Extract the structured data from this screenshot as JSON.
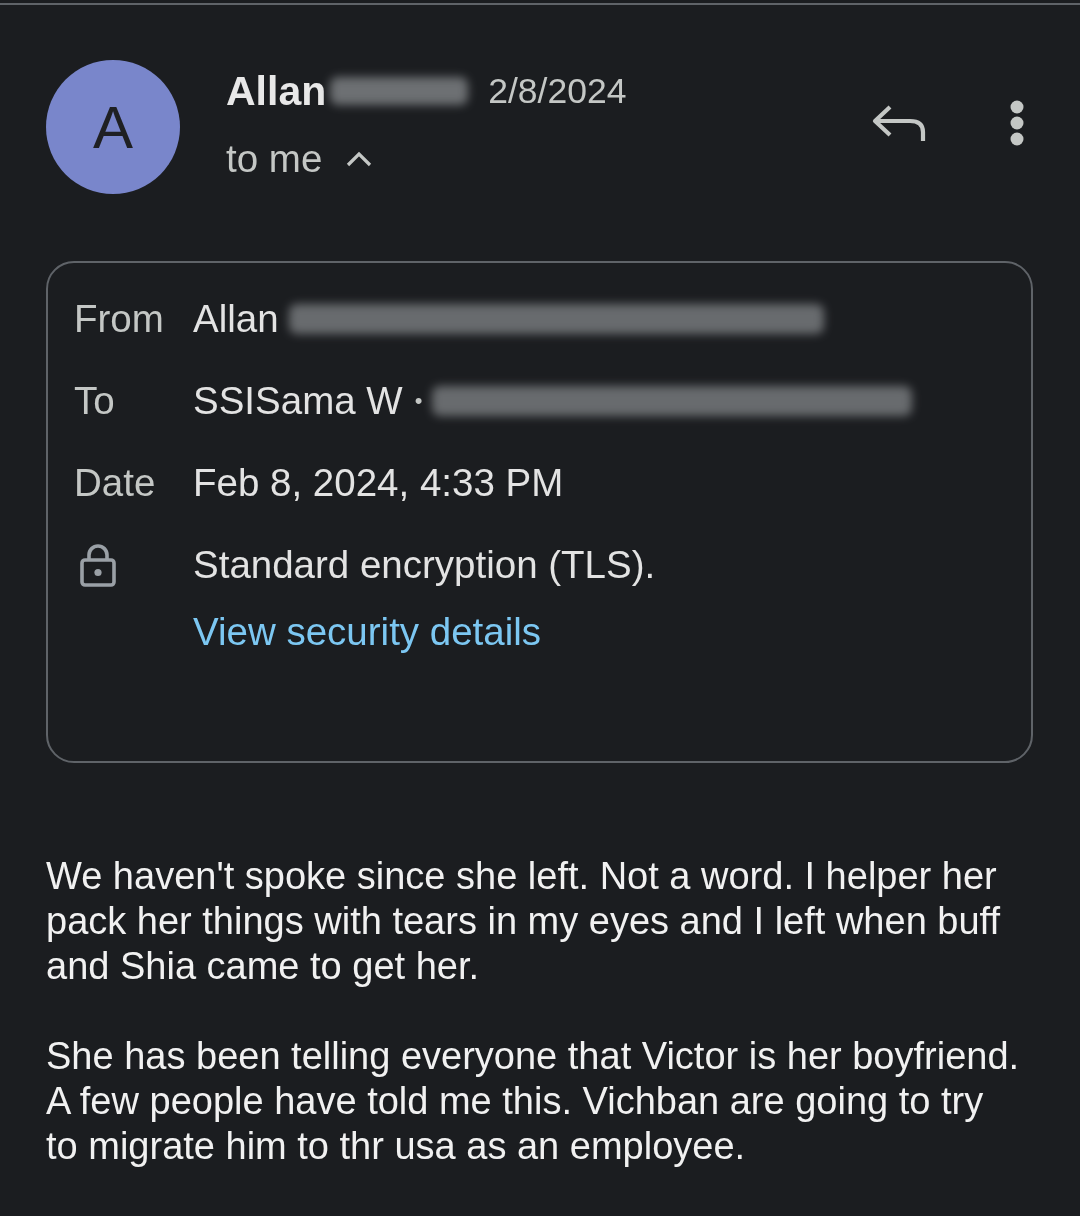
{
  "header": {
    "avatar_letter": "A",
    "sender_name": "Allan",
    "name_redacted": true,
    "date": "2/8/2024",
    "recipient_summary": "to me",
    "details_expanded": true
  },
  "details": {
    "rows": [
      {
        "label": "From",
        "value": "Allan",
        "separator": "",
        "redacted": true
      },
      {
        "label": "To",
        "value": "SSISama W",
        "separator": "•",
        "redacted": true
      },
      {
        "label": "Date",
        "value": "Feb 8, 2024, 4:33 PM",
        "separator": "",
        "redacted": false
      }
    ],
    "security": {
      "text": "Standard encryption (TLS).",
      "link": "View security details"
    }
  },
  "body": {
    "paragraphs": [
      "We haven't spoke since she left. Not a word. I helper her pack her things with tears in my eyes and I left when buff and Shia came to get her.",
      "She has been telling everyone that Victor is her boyfriend. A few people have told me this. Vichban are going to try to migrate him to thr usa as an employee."
    ]
  }
}
